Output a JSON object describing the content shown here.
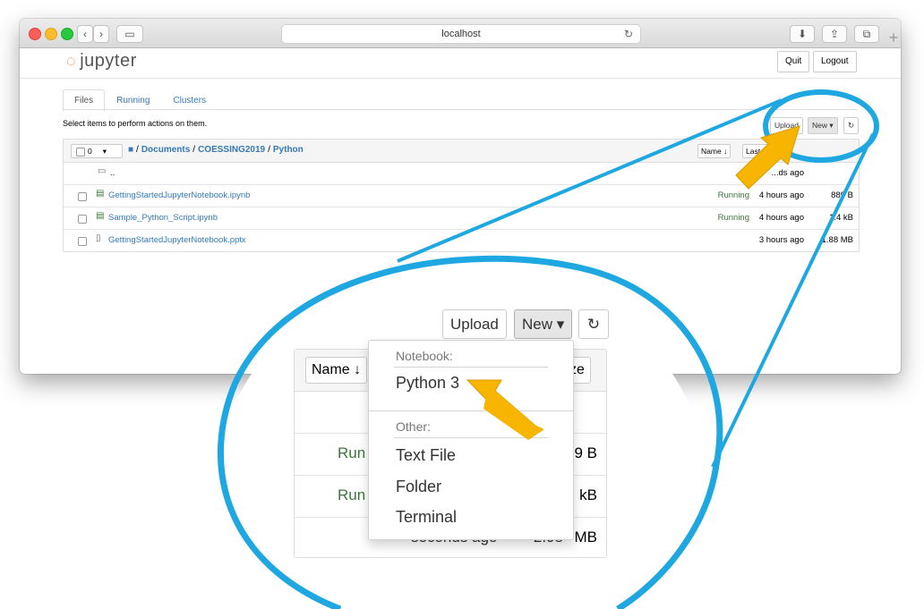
{
  "browser": {
    "url": "localhost",
    "buttons": {
      "back": "‹",
      "forward": "›",
      "sidebar": "▭",
      "download": "⬇",
      "share": "⇪",
      "tabs": "⧉",
      "new_tab": "+"
    }
  },
  "jupyter": {
    "logo": "jupyter",
    "quit_label": "Quit",
    "logout_label": "Logout",
    "tabs": [
      "Files",
      "Running",
      "Clusters"
    ],
    "hint": "Select items to perform actions on them.",
    "upload_label": "Upload",
    "new_label": "New ▾",
    "refresh_icon": "↻",
    "selected_count": "0",
    "breadcrumb": [
      "Documents",
      "COESSING2019",
      "Python"
    ],
    "sort_name_label": "Name ↓",
    "sort_modified_label": "Last M",
    "parent_dir": "..",
    "rows": [
      {
        "name": "..",
        "status": "",
        "modified": "...ds ago",
        "size": ""
      },
      {
        "name": "GettingStartedJupyterNotebook.ipynb",
        "status": "Running",
        "modified": "4 hours ago",
        "size": "889 B"
      },
      {
        "name": "Sample_Python_Script.ipynb",
        "status": "Running",
        "modified": "4 hours ago",
        "size": "1.4 kB"
      },
      {
        "name": "GettingStartedJupyterNotebook.pptx",
        "status": "",
        "modified": "3 hours ago",
        "size": "1.88 MB"
      }
    ]
  },
  "zoom": {
    "upload_label": "Upload",
    "new_label": "New ▾",
    "refresh_icon": "↻",
    "sort_name_label": "Name ↓",
    "sort_size_label": "ze",
    "row_texts": [
      {
        "status": "Run",
        "size": "9 B"
      },
      {
        "status": "Run",
        "size": "kB"
      },
      {
        "status": "",
        "size": "MB",
        "modified": "seconds ago",
        "partial": "2.98"
      }
    ],
    "menu": {
      "notebook_header": "Notebook:",
      "python3": "Python 3",
      "other_header": "Other:",
      "text_file": "Text File",
      "folder": "Folder",
      "terminal": "Terminal"
    }
  },
  "colors": {
    "highlight_ring": "#1ea7e1",
    "arrow": "#f7b500",
    "link": "#337ab7",
    "running": "#3c763d"
  }
}
